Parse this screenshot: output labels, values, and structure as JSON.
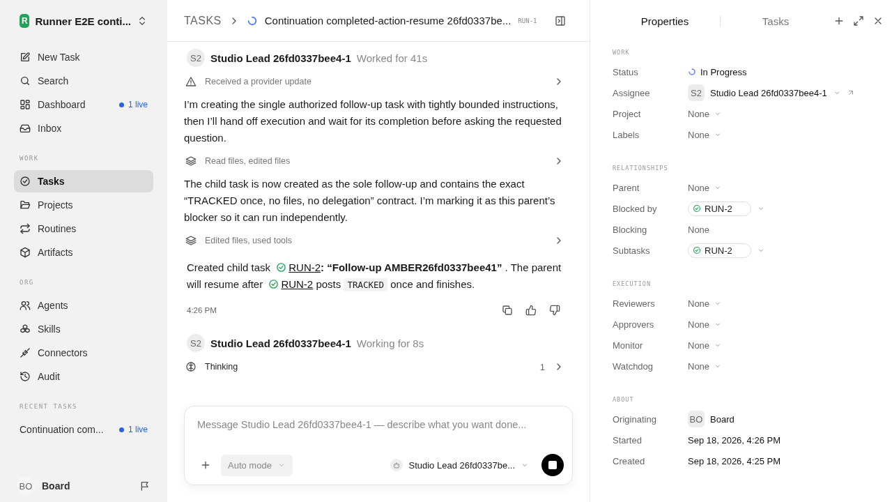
{
  "workspace": {
    "initial": "R",
    "name": "Runner E2E conti..."
  },
  "nav": [
    {
      "label": "New Task",
      "selected": false
    },
    {
      "label": "Search",
      "selected": false
    },
    {
      "label": "Dashboard",
      "selected": false,
      "badge": "1 live"
    },
    {
      "label": "Inbox",
      "selected": false
    }
  ],
  "sections": [
    {
      "title": "WORK",
      "items": [
        {
          "label": "Tasks",
          "selected": true
        },
        {
          "label": "Projects",
          "selected": false
        },
        {
          "label": "Routines",
          "selected": false
        },
        {
          "label": "Artifacts",
          "selected": false
        }
      ]
    },
    {
      "title": "ORG",
      "items": [
        {
          "label": "Agents",
          "selected": false
        },
        {
          "label": "Skills",
          "selected": false
        },
        {
          "label": "Connectors",
          "selected": false
        },
        {
          "label": "Audit",
          "selected": false
        }
      ]
    }
  ],
  "recent": {
    "title": "RECENT TASKS",
    "items": [
      {
        "label": "Continuation com...",
        "badge": "1 live"
      }
    ]
  },
  "user": {
    "initials": "BO",
    "name": "Board"
  },
  "header": {
    "crumb": "TASKS",
    "title": "Continuation completed-action-resume 26fd0337be...",
    "id": "RUN-1"
  },
  "feed": [
    {
      "kind": "agent",
      "initials": "S2",
      "name": "Studio Lead 26fd0337bee4-1",
      "status": "Worked for 41s"
    },
    {
      "kind": "notice",
      "label": "Received a provider update"
    },
    {
      "kind": "text",
      "text": "I’m creating the single authorized follow-up task with tightly bounded instructions, then I’ll hand off execution and wait for its completion before asking the requested question."
    },
    {
      "kind": "tools",
      "label": "Read files, edited files"
    },
    {
      "kind": "text",
      "text": "The child task is now created as the sole follow-up and contains the exact “TRACKED once, no files, no delegation” contract. I’m marking it as this parent’s blocker so it can run independently."
    },
    {
      "kind": "tools",
      "label": "Edited files, used tools"
    },
    {
      "kind": "rich",
      "segments": [
        {
          "kind": "text",
          "text": "Created child task"
        },
        {
          "kind": "task",
          "text": "RUN-2"
        },
        {
          "kind": "bold",
          "text": ": “Follow-up AMBER26fd0337bee41”"
        },
        {
          "kind": "text",
          "text": ". The parent will resume after"
        },
        {
          "kind": "task",
          "text": "RUN-2"
        },
        {
          "kind": "text",
          "text": "posts"
        },
        {
          "kind": "code",
          "text": "TRACKED"
        },
        {
          "kind": "text",
          "text": "once and finishes."
        }
      ]
    },
    {
      "kind": "meta",
      "time": "4:26 PM"
    },
    {
      "kind": "agent",
      "initials": "S2",
      "name": "Studio Lead 26fd0337bee4-1",
      "status": "Working for 8s"
    },
    {
      "kind": "thinking",
      "label": "Thinking",
      "count": "1"
    }
  ],
  "composer": {
    "placeholder": "Message Studio Lead 26fd0337bee4-1 — describe what you want done...",
    "mode": "Auto mode",
    "agent": "Studio Lead 26fd0337be..."
  },
  "panel": {
    "tabs": [
      {
        "label": "Properties",
        "selected": true
      },
      {
        "label": "Tasks",
        "selected": false
      }
    ],
    "groups": [
      {
        "title": "WORK",
        "rows": [
          {
            "label": "Status",
            "kind": "status",
            "value": "In Progress"
          },
          {
            "label": "Assignee",
            "kind": "person",
            "initials": "S2",
            "value": "Studio Lead 26fd0337bee4-1"
          },
          {
            "label": "Project",
            "kind": "select",
            "value": "None"
          },
          {
            "label": "Labels",
            "kind": "select",
            "value": "None"
          }
        ]
      },
      {
        "title": "RELATIONSHIPS",
        "rows": [
          {
            "label": "Parent",
            "kind": "select",
            "value": "None"
          },
          {
            "label": "Blocked by",
            "kind": "chip",
            "value": "RUN-2"
          },
          {
            "label": "Blocking",
            "kind": "plain",
            "value": "None"
          },
          {
            "label": "Subtasks",
            "kind": "chip",
            "value": "RUN-2"
          }
        ]
      },
      {
        "title": "EXECUTION",
        "rows": [
          {
            "label": "Reviewers",
            "kind": "select",
            "value": "None"
          },
          {
            "label": "Approvers",
            "kind": "select",
            "value": "None"
          },
          {
            "label": "Monitor",
            "kind": "select",
            "value": "None"
          },
          {
            "label": "Watchdog",
            "kind": "select",
            "value": "None"
          }
        ]
      },
      {
        "title": "ABOUT",
        "rows": [
          {
            "label": "Originating",
            "kind": "person",
            "initials": "BO",
            "value": "Board"
          },
          {
            "label": "Started",
            "kind": "date",
            "value": "Sep 18, 2026, 4:26 PM"
          },
          {
            "label": "Created",
            "kind": "date",
            "value": "Sep 18, 2026, 4:25 PM"
          }
        ]
      }
    ]
  }
}
